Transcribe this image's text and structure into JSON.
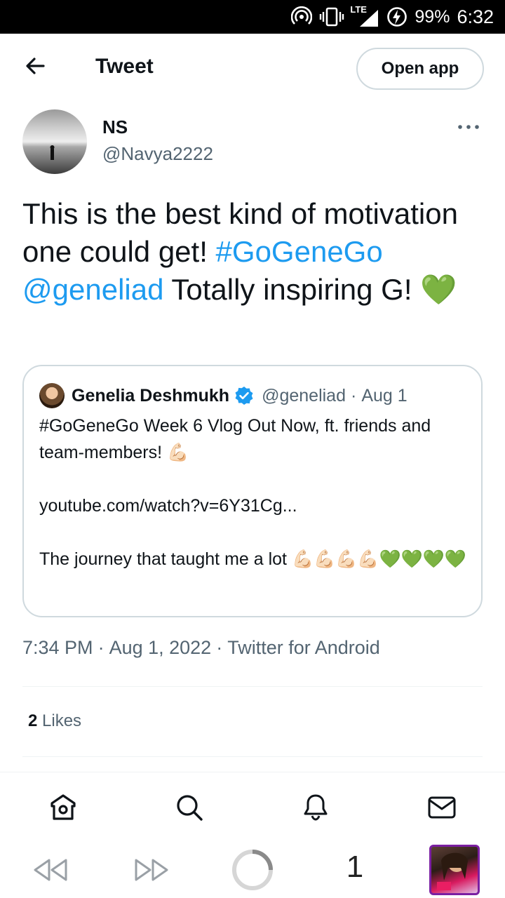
{
  "status_bar": {
    "battery": "99%",
    "time": "6:32",
    "network": "LTE"
  },
  "header": {
    "title": "Tweet",
    "open_app_label": "Open app"
  },
  "author": {
    "name": "NS",
    "handle": "@Navya2222"
  },
  "tweet": {
    "text_1": "This is the best kind of motivation one could get! ",
    "hashtag": "#GoGeneGo",
    "mention": "@geneliad",
    "text_2": " Totally inspiring G! ",
    "emoji": "💚"
  },
  "quote": {
    "name": "Genelia Deshmukh",
    "handle": "@geneliad",
    "date": "Aug 1",
    "line_1": "#GoGeneGo Week 6 Vlog Out Now, ft. friends and team-members! ",
    "arm_emoji": "💪🏻",
    "link": "youtube.com/watch?v=6Y31Cg...",
    "line_2": "The journey that taught me a lot ",
    "emoji_tail_1": "💪🏻💪🏻💪🏻💪🏻",
    "emoji_tail_2": "💚💚💚💚"
  },
  "meta": {
    "time": "7:34 PM",
    "date": "Aug 1, 2022",
    "source": "Twitter for Android"
  },
  "stats": {
    "likes_count": "2",
    "likes_label": "Likes"
  },
  "bottom_nav": [
    "home-icon",
    "search-icon",
    "notifications-icon",
    "messages-icon"
  ],
  "browser_bar": {
    "tab_count": "1"
  },
  "colors": {
    "link": "#1d9bf0",
    "text": "#0f1419",
    "secondary": "#536471",
    "heart": "#78b159",
    "border": "#cfd9de"
  }
}
